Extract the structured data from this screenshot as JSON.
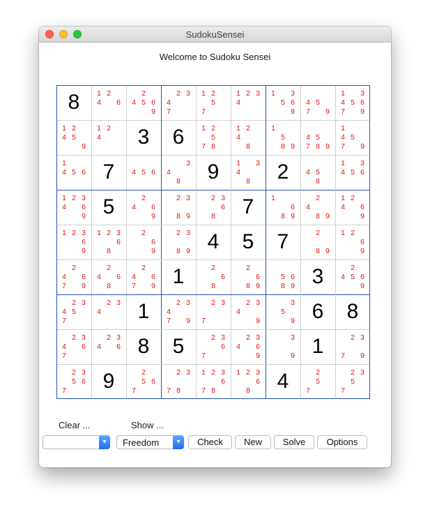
{
  "window": {
    "title": "SudokuSensei"
  },
  "welcome_text": "Welcome to Sudoku Sensei",
  "board": {
    "cells": [
      [
        {
          "v": 8
        },
        {
          "c": [
            1,
            2,
            4,
            6
          ]
        },
        {
          "c": [
            2,
            4,
            5,
            6,
            9
          ]
        },
        {
          "c": [
            2,
            3,
            4,
            7
          ]
        },
        {
          "c": [
            1,
            2,
            5,
            7
          ]
        },
        {
          "c": [
            1,
            2,
            3,
            4
          ]
        },
        {
          "c": [
            1,
            3,
            5,
            6,
            9
          ]
        },
        {
          "c": [
            4,
            5,
            7,
            9
          ]
        },
        {
          "c": [
            1,
            3,
            4,
            5,
            6,
            7,
            9
          ]
        }
      ],
      [
        {
          "c": [
            1,
            2,
            4,
            5,
            9
          ]
        },
        {
          "c": [
            1,
            2,
            4
          ]
        },
        {
          "v": 3
        },
        {
          "v": 6
        },
        {
          "c": [
            1,
            2,
            5,
            7,
            8
          ]
        },
        {
          "c": [
            1,
            2,
            4,
            8
          ]
        },
        {
          "c": [
            1,
            5,
            8,
            9
          ]
        },
        {
          "c": [
            4,
            5,
            7,
            8,
            9
          ]
        },
        {
          "c": [
            1,
            4,
            5,
            7,
            9
          ]
        }
      ],
      [
        {
          "c": [
            1,
            4,
            5,
            6
          ]
        },
        {
          "v": 7
        },
        {
          "c": [
            4,
            5,
            6
          ]
        },
        {
          "c": [
            3,
            4,
            8
          ]
        },
        {
          "v": 9
        },
        {
          "c": [
            1,
            3,
            4,
            8
          ]
        },
        {
          "v": 2
        },
        {
          "c": [
            4,
            5,
            8
          ]
        },
        {
          "c": [
            1,
            3,
            4,
            5,
            6
          ]
        }
      ],
      [
        {
          "c": [
            1,
            2,
            3,
            4,
            6,
            9
          ]
        },
        {
          "v": 5
        },
        {
          "c": [
            2,
            4,
            6,
            9
          ]
        },
        {
          "c": [
            2,
            3,
            8,
            9
          ]
        },
        {
          "c": [
            2,
            3,
            6,
            8
          ]
        },
        {
          "v": 7
        },
        {
          "c": [
            1,
            6,
            8,
            9
          ]
        },
        {
          "c": [
            2,
            4,
            8,
            9
          ]
        },
        {
          "c": [
            1,
            2,
            4,
            6,
            9
          ]
        }
      ],
      [
        {
          "c": [
            1,
            2,
            3,
            6,
            9
          ]
        },
        {
          "c": [
            1,
            2,
            3,
            6,
            8
          ]
        },
        {
          "c": [
            2,
            6,
            9
          ]
        },
        {
          "c": [
            2,
            3,
            8,
            9
          ]
        },
        {
          "v": 4
        },
        {
          "v": 5
        },
        {
          "v": 7
        },
        {
          "c": [
            2,
            8,
            9
          ]
        },
        {
          "c": [
            1,
            2,
            6,
            9
          ]
        }
      ],
      [
        {
          "c": [
            2,
            4,
            6,
            7,
            9
          ]
        },
        {
          "c": [
            2,
            4,
            6,
            8
          ]
        },
        {
          "c": [
            2,
            4,
            6,
            7,
            9
          ]
        },
        {
          "v": 1
        },
        {
          "c": [
            2,
            6,
            8
          ]
        },
        {
          "c": [
            2,
            6,
            8,
            9
          ]
        },
        {
          "c": [
            5,
            6,
            8,
            9
          ]
        },
        {
          "v": 3
        },
        {
          "c": [
            2,
            4,
            5,
            6,
            9
          ]
        }
      ],
      [
        {
          "c": [
            2,
            3,
            4,
            5,
            7
          ]
        },
        {
          "c": [
            2,
            3,
            4
          ]
        },
        {
          "v": 1
        },
        {
          "c": [
            2,
            3,
            4,
            7,
            9
          ]
        },
        {
          "c": [
            2,
            3,
            7
          ]
        },
        {
          "c": [
            2,
            3,
            4,
            9
          ]
        },
        {
          "c": [
            3,
            5,
            9
          ]
        },
        {
          "v": 6
        },
        {
          "v": 8
        }
      ],
      [
        {
          "c": [
            2,
            3,
            4,
            6,
            7
          ]
        },
        {
          "c": [
            2,
            3,
            4,
            6
          ]
        },
        {
          "v": 8
        },
        {
          "v": 5
        },
        {
          "c": [
            2,
            3,
            6,
            7
          ]
        },
        {
          "c": [
            2,
            3,
            4,
            6,
            9
          ]
        },
        {
          "c": [
            3,
            9
          ]
        },
        {
          "v": 1
        },
        {
          "c": [
            2,
            3,
            7,
            9
          ]
        }
      ],
      [
        {
          "c": [
            2,
            3,
            5,
            6,
            7
          ]
        },
        {
          "v": 9
        },
        {
          "c": [
            2,
            5,
            6,
            7
          ]
        },
        {
          "c": [
            2,
            3,
            7,
            8
          ]
        },
        {
          "c": [
            1,
            2,
            3,
            6,
            7,
            8
          ]
        },
        {
          "c": [
            1,
            2,
            3,
            6,
            8
          ]
        },
        {
          "v": 4
        },
        {
          "c": [
            2,
            5,
            7
          ]
        },
        {
          "c": [
            2,
            3,
            5,
            7
          ]
        }
      ]
    ]
  },
  "controls": {
    "clear_label": "Clear ...",
    "show_label": "Show ...",
    "clear_select_value": "",
    "show_select_value": "Freedom",
    "check_label": "Check",
    "new_label": "New",
    "solve_label": "Solve",
    "options_label": "Options"
  },
  "colors": {
    "given_digit": "#000000",
    "candidate_digit": "#e0130e",
    "box_border": "#1f53b5",
    "cell_border": "#cfcfcf",
    "select_accent": "#2f80ff"
  }
}
